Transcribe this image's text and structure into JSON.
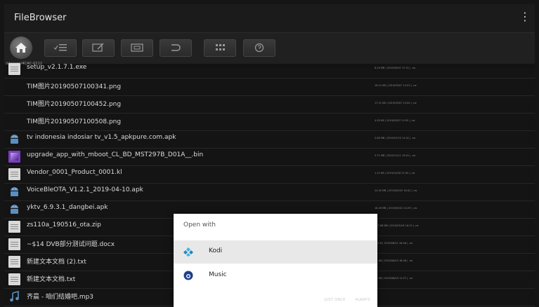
{
  "app": {
    "title": "FileBrowser",
    "menu_glyph": "⋮"
  },
  "path": "/storage/4CAC-0112",
  "files": [
    {
      "name": "setup_v2.1.7.1.exe",
      "meta": "8.29 MB | 2019/05/07 17:31 | -rw",
      "type": "file"
    },
    {
      "name": "TIM图片20190507100341.png",
      "meta": "16.12 KB | 2019/05/07 12:03 | -rw",
      "type": "image"
    },
    {
      "name": "TIM图片20190507100452.png",
      "meta": "17.21 KB | 2019/05/07 12:04 | -rw",
      "type": "image"
    },
    {
      "name": "TIM图片20190507100508.png",
      "meta": "4.09 KB | 2019/05/07 12:05 | -rw",
      "type": "image"
    },
    {
      "name": "tv indonesia indosiar tv_v1.5_apkpure.com.apk",
      "meta": "2.80 MB | 2019/07/10 11:41 | -rw",
      "type": "apk"
    },
    {
      "name": "upgrade_app_with_mboot_CL_BD_MST297B_D01A__.bin",
      "meta": "3.71 MB | 2019/11/11 19:41 | -rw",
      "type": "bin"
    },
    {
      "name": "Vendor_0001_Product_0001.kl",
      "meta": "1.12 KB | 2019/10/18 11:55 | -rw",
      "type": "file"
    },
    {
      "name": "VoiceBleOTA_V1.2.1_2019-04-10.apk",
      "meta": "24.92 MB | 2019/05/20 16:42 | -rw",
      "type": "apk"
    },
    {
      "name": "yktv_6.9.3.1_dangbei.apk",
      "meta": "18.49 MB | 2019/05/22 14:29 | -rw",
      "type": "apk"
    },
    {
      "name": "zs110a_190516_ota.zip",
      "meta": "327.68 MB | 2019/05/16 16:13 | -rw",
      "type": "file"
    },
    {
      "name": "~$14 DVB部分测试问题.docx",
      "meta": "162 B | 2019/06/21 18:46 | -rw",
      "type": "file"
    },
    {
      "name": "新建文本文档 (2).txt",
      "meta": "43 KB | 2019/08/04 18:46 | -rw",
      "type": "file"
    },
    {
      "name": "新建文本文档.txt",
      "meta": "48 KB | 2019/08/04 11:27 | -rw",
      "type": "file"
    },
    {
      "name": "齐晨 - 咱们结婚吧.mp3",
      "meta": "",
      "type": "music"
    }
  ],
  "dialog": {
    "title": "Open with",
    "options": [
      {
        "label": "Kodi",
        "icon": "kodi-icon",
        "selected": true
      },
      {
        "label": "Music",
        "icon": "music-app-icon",
        "selected": false
      }
    ],
    "buttons": {
      "just_once": "JUST ONCE",
      "always": "ALWAYS"
    }
  },
  "colors": {
    "background": "#141414",
    "dialog": "#ffffff",
    "image_icon": "#e2901e",
    "apk_icon": "#5a8fc0"
  }
}
